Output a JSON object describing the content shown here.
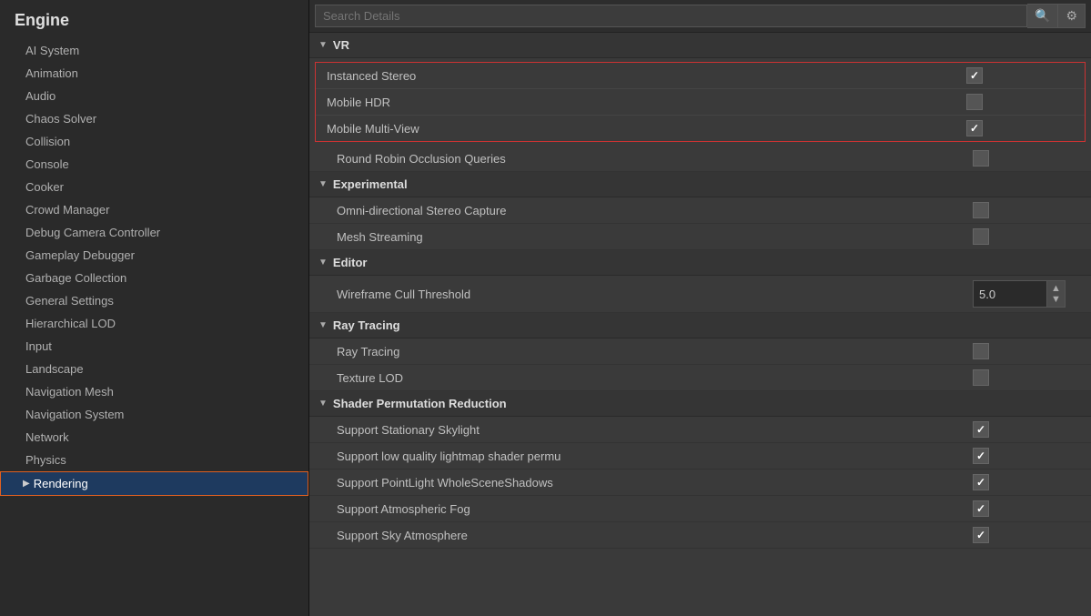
{
  "sidebar": {
    "title": "Engine",
    "items": [
      {
        "label": "AI System",
        "active": false
      },
      {
        "label": "Animation",
        "active": false
      },
      {
        "label": "Audio",
        "active": false
      },
      {
        "label": "Chaos Solver",
        "active": false
      },
      {
        "label": "Collision",
        "active": false
      },
      {
        "label": "Console",
        "active": false
      },
      {
        "label": "Cooker",
        "active": false
      },
      {
        "label": "Crowd Manager",
        "active": false
      },
      {
        "label": "Debug Camera Controller",
        "active": false
      },
      {
        "label": "Gameplay Debugger",
        "active": false
      },
      {
        "label": "Garbage Collection",
        "active": false
      },
      {
        "label": "General Settings",
        "active": false
      },
      {
        "label": "Hierarchical LOD",
        "active": false
      },
      {
        "label": "Input",
        "active": false
      },
      {
        "label": "Landscape",
        "active": false
      },
      {
        "label": "Navigation Mesh",
        "active": false
      },
      {
        "label": "Navigation System",
        "active": false
      },
      {
        "label": "Network",
        "active": false
      },
      {
        "label": "Physics",
        "active": false
      },
      {
        "label": "Rendering",
        "active": true
      }
    ]
  },
  "search": {
    "placeholder": "Search Details"
  },
  "sections": {
    "vr": {
      "title": "VR",
      "settings": [
        {
          "label": "Instanced Stereo",
          "type": "checkbox",
          "checked": true,
          "highlighted": true
        },
        {
          "label": "Mobile HDR",
          "type": "checkbox",
          "checked": false,
          "highlighted": true
        },
        {
          "label": "Mobile Multi-View",
          "type": "checkbox",
          "checked": true,
          "highlighted": true
        },
        {
          "label": "Round Robin Occlusion Queries",
          "type": "checkbox",
          "checked": false,
          "highlighted": false
        }
      ]
    },
    "experimental": {
      "title": "Experimental",
      "settings": [
        {
          "label": "Omni-directional Stereo Capture",
          "type": "checkbox",
          "checked": false
        },
        {
          "label": "Mesh Streaming",
          "type": "checkbox",
          "checked": false
        }
      ]
    },
    "editor": {
      "title": "Editor",
      "settings": [
        {
          "label": "Wireframe Cull Threshold",
          "type": "number",
          "value": "5.0"
        }
      ]
    },
    "ray_tracing": {
      "title": "Ray Tracing",
      "settings": [
        {
          "label": "Ray Tracing",
          "type": "checkbox",
          "checked": false
        },
        {
          "label": "Texture LOD",
          "type": "checkbox",
          "checked": false
        }
      ]
    },
    "shader": {
      "title": "Shader Permutation Reduction",
      "settings": [
        {
          "label": "Support Stationary Skylight",
          "type": "checkbox",
          "checked": true
        },
        {
          "label": "Support low quality lightmap shader permu",
          "type": "checkbox",
          "checked": true
        },
        {
          "label": "Support PointLight WholeSceneShadows",
          "type": "checkbox",
          "checked": true
        },
        {
          "label": "Support Atmospheric Fog",
          "type": "checkbox",
          "checked": true
        },
        {
          "label": "Support Sky Atmosphere",
          "type": "checkbox",
          "checked": true
        }
      ]
    }
  },
  "icons": {
    "search": "🔍",
    "settings": "⚙",
    "arrow_down": "▼",
    "arrow_right": "▶",
    "spin": "▲▼"
  }
}
